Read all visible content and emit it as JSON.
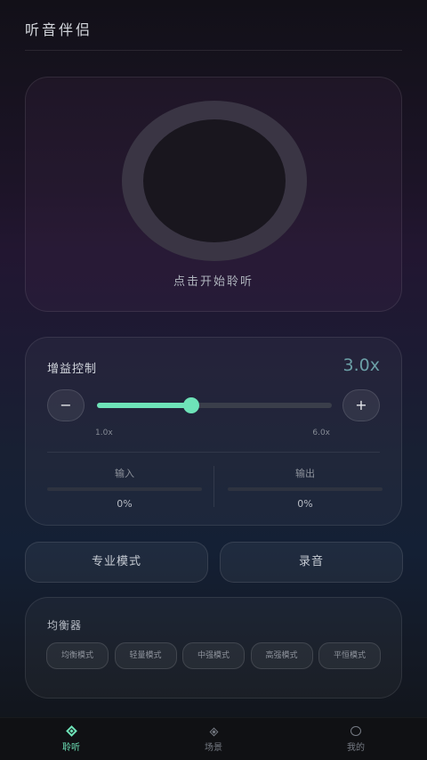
{
  "app": {
    "title": "听音伴侣"
  },
  "listen": {
    "label": "点击开始聆听"
  },
  "gain": {
    "title": "增益控制",
    "value_text": "3.0x",
    "value": 3.0,
    "min": 1.0,
    "max": 6.0,
    "min_label": "1.0x",
    "max_label": "6.0x",
    "minus_label": "−",
    "plus_label": "+",
    "input": {
      "label": "输入",
      "value": "0%"
    },
    "output": {
      "label": "输出",
      "value": "0%"
    }
  },
  "actions": {
    "pro_mode": "专业模式",
    "record": "录音"
  },
  "equalizer": {
    "title": "均衡器",
    "presets": [
      "均衡模式",
      "轻量模式",
      "中强模式",
      "高强模式",
      "平恒模式"
    ]
  },
  "nav": {
    "items": [
      {
        "label": "聆听",
        "icon": "listen-diamond-icon",
        "active": true
      },
      {
        "label": "场景",
        "icon": "scene-diamond-icon",
        "active": false
      },
      {
        "label": "我的",
        "icon": "profile-circle-icon",
        "active": false
      }
    ]
  },
  "colors": {
    "accent": "#6ee3b8",
    "gain_value": "#6b9fa6"
  }
}
